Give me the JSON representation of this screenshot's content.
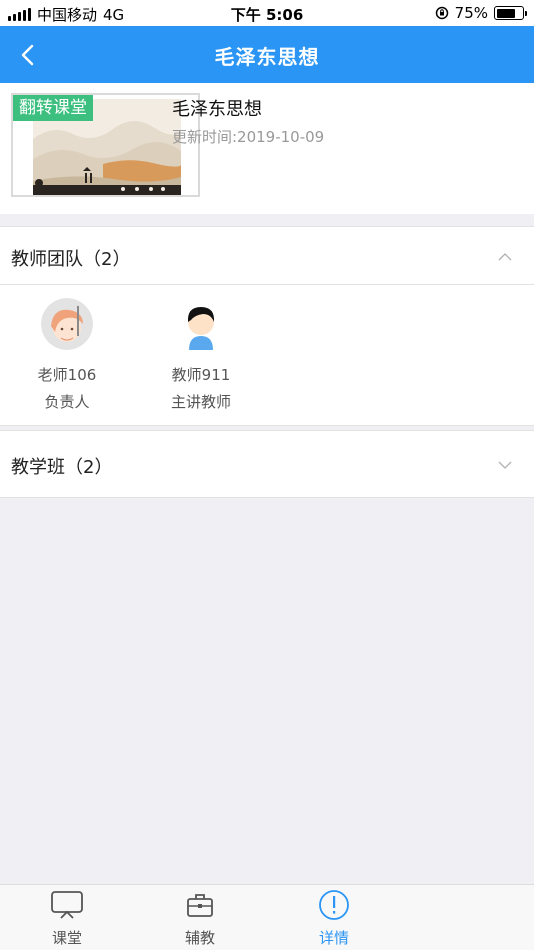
{
  "status_bar": {
    "carrier": "中国移动",
    "network": "4G",
    "time": "下午 5:06",
    "battery": "75%",
    "battery_level": 0.75
  },
  "nav": {
    "title": "毛泽东思想",
    "back_icon": "chevron-left-icon"
  },
  "course": {
    "tag": "翻转课堂",
    "title": "毛泽东思想",
    "updated": "更新时间:2019-10-09"
  },
  "team": {
    "title": "教师团队（2）",
    "expanded": true,
    "members": [
      {
        "name": "老师106",
        "role": "负责人",
        "avatar": "cartoon-girl-avatar"
      },
      {
        "name": "教师911",
        "role": "主讲教师",
        "avatar": "default-person-avatar"
      }
    ]
  },
  "classes": {
    "title": "教学班（2）",
    "expanded": false
  },
  "tabs": [
    {
      "label": "课堂",
      "icon": "screen-icon",
      "active": false
    },
    {
      "label": "辅教",
      "icon": "briefcase-icon",
      "active": false
    },
    {
      "label": "详情",
      "icon": "info-icon",
      "active": true
    }
  ],
  "colors": {
    "primary": "#2b95f5",
    "tag_green": "#3cbf7f",
    "background": "#efeff4"
  }
}
